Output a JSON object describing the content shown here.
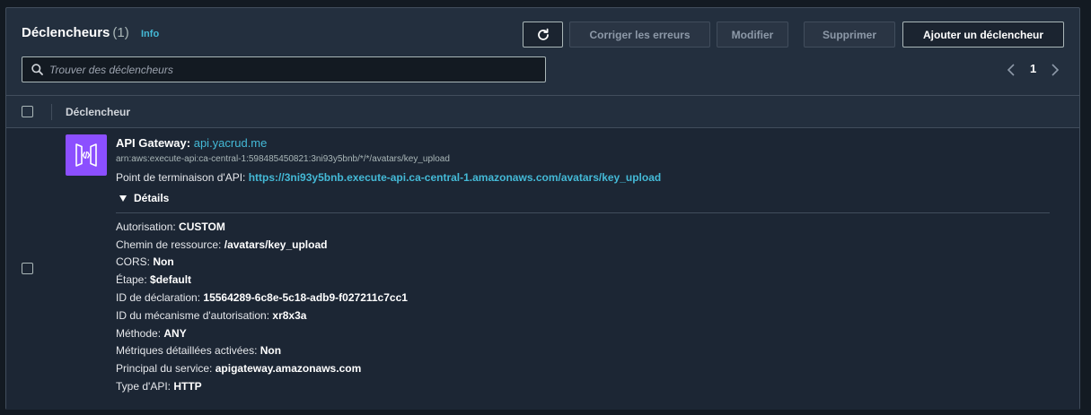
{
  "header": {
    "title": "Déclencheurs",
    "count": "(1)",
    "info_label": "Info"
  },
  "toolbar": {
    "refresh_icon": "refresh-icon",
    "fix_errors_label": "Corriger les erreurs",
    "edit_label": "Modifier",
    "delete_label": "Supprimer",
    "add_trigger_label": "Ajouter un déclencheur"
  },
  "search": {
    "placeholder": "Trouver des déclencheurs",
    "value": ""
  },
  "pagination": {
    "current_page": "1"
  },
  "table": {
    "column_header": "Déclencheur"
  },
  "trigger": {
    "service_name": "API Gateway:",
    "api_name": "api.yacrud.me",
    "arn": "arn:aws:execute-api:ca-central-1:598485450821:3ni93y5bnb/*/*/avatars/key_upload",
    "endpoint_label": "Point de terminaison d'API:",
    "endpoint_url": "https://3ni93y5bnb.execute-api.ca-central-1.amazonaws.com/avatars/key_upload",
    "details_label": "Détails",
    "details": [
      {
        "label": "Autorisation:",
        "value": "CUSTOM"
      },
      {
        "label": "Chemin de ressource:",
        "value": "/avatars/key_upload"
      },
      {
        "label": "CORS:",
        "value": "Non"
      },
      {
        "label": "Étape:",
        "value": "$default"
      },
      {
        "label": "ID de déclaration:",
        "value": "15564289-6c8e-5c18-adb9-f027211c7cc1"
      },
      {
        "label": "ID du mécanisme d'autorisation:",
        "value": "xr8x3a"
      },
      {
        "label": "Méthode:",
        "value": "ANY"
      },
      {
        "label": "Métriques détaillées activées:",
        "value": "Non"
      },
      {
        "label": "Principal du service:",
        "value": "apigateway.amazonaws.com"
      },
      {
        "label": "Type d'API:",
        "value": "HTTP"
      }
    ]
  },
  "colors": {
    "link": "#44b9d6",
    "service_icon_bg": "#8c4fff"
  }
}
